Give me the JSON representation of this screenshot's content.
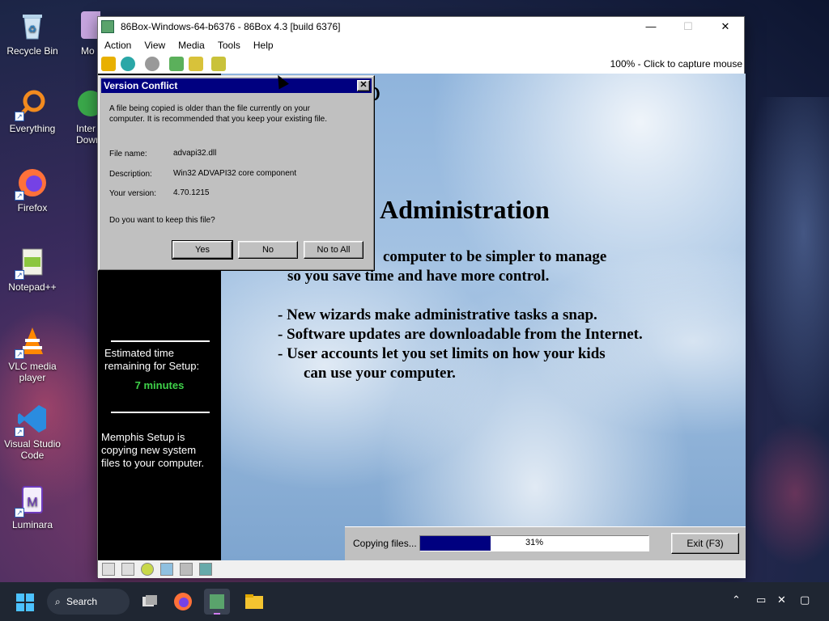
{
  "desktop": {
    "icons": [
      {
        "label": "Recycle Bin"
      },
      {
        "label": "Everything"
      },
      {
        "label": "Firefox"
      },
      {
        "label": "Notepad++"
      },
      {
        "label": "VLC media player"
      },
      {
        "label": "Visual Studio Code"
      },
      {
        "label": "Luminara"
      },
      {
        "label": "Mo"
      },
      {
        "label": "Inter Down"
      }
    ]
  },
  "window": {
    "title": "86Box-Windows-64-b6376 - 86Box 4.3 [build 6376]",
    "controls": {
      "minimize": "—",
      "maximize": "☐",
      "close": "✕"
    },
    "menu": [
      "Action",
      "View",
      "Media",
      "Tools",
      "Help"
    ],
    "status_right": "100% - Click to capture mouse"
  },
  "setup": {
    "heading_partial": "p",
    "title": "Administration",
    "lines": [
      "computer to be simpler to manage",
      "so you save time and have more control.",
      "- New wizards make administrative tasks a snap.",
      "- Software updates are downloadable from the Internet.",
      "- User accounts let you set limits on how your kids",
      "can use your computer."
    ],
    "estimate_label": "Estimated time remaining for Setup:",
    "estimate_value": "7 minutes",
    "copying_info": "Memphis Setup is copying new system files to your computer.",
    "progress_label": "Copying files...",
    "progress_percent": 31,
    "progress_text": "31%",
    "exit_label": "Exit (F3)"
  },
  "dialog": {
    "title": "Version Conflict",
    "close": "✕",
    "message_line1": "A file being copied is older than the file currently on your",
    "message_line2": "computer. It is recommended that you keep your existing file.",
    "file_name_label": "File name:",
    "file_name": "advapi32.dll",
    "description_label": "Description:",
    "description": "Win32 ADVAPI32 core component",
    "version_label": "Your version:",
    "version": "4.70.1215",
    "question": "Do you want to keep this file?",
    "buttons": {
      "yes": "Yes",
      "no": "No",
      "no_to_all": "No to All"
    }
  },
  "taskbar": {
    "search_label": "Search"
  },
  "colors": {
    "dialog_title_bg": "#000080",
    "progress_fill": "#000080",
    "minutes_green": "#3fd24a",
    "win95_gray": "#c0c0c0"
  }
}
